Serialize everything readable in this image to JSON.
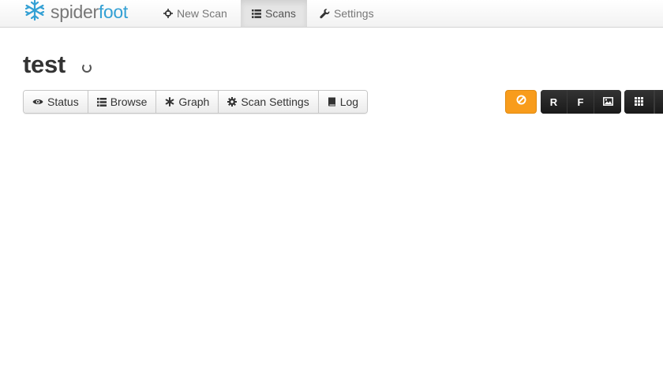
{
  "brand": {
    "spider": "spider",
    "foot": "foot",
    "logo_icon": "snowflake-logo-icon"
  },
  "nav": {
    "new_scan": {
      "label": "New Scan",
      "icon": "crosshair-icon"
    },
    "scans": {
      "label": "Scans",
      "icon": "list-icon",
      "active": true
    },
    "settings": {
      "label": "Settings",
      "icon": "wrench-icon"
    }
  },
  "scan": {
    "title": "test",
    "status_icon": "loading-spinner-icon"
  },
  "tabs": [
    {
      "label": "Status",
      "icon": "eye-icon"
    },
    {
      "label": "Browse",
      "icon": "list-icon"
    },
    {
      "label": "Graph",
      "icon": "asterisk-icon"
    },
    {
      "label": "Scan Settings",
      "icon": "cog-icon"
    },
    {
      "label": "Log",
      "icon": "book-icon"
    }
  ],
  "actions": {
    "abort_icon": "ban-icon",
    "abort_color": "#f89c1c",
    "export_r": "R",
    "export_f": "F",
    "export_image_icon": "picture-icon",
    "grid_icon": "grid-icon",
    "dark_color": "#222222"
  },
  "colors": {
    "brand_blue": "#33a0d4",
    "nav_text": "#777777"
  }
}
